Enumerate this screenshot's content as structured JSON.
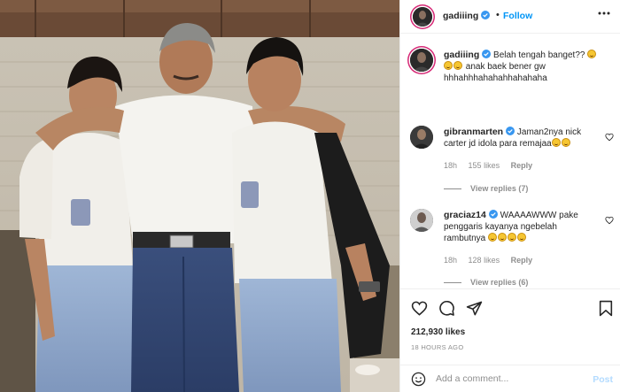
{
  "header": {
    "username": "gadiiing",
    "separator": "•",
    "follow_label": "Follow"
  },
  "caption": {
    "username": "gadiiing",
    "text_1": "Belah tengah banget??",
    "text_2": "anak baek bener gw hhhahhhahahahhahahaha"
  },
  "comments": [
    {
      "username": "gibranmarten",
      "text": "Jaman2nya nick carter jd idola para remajaa",
      "time": "18h",
      "likes": "155 likes",
      "reply_label": "Reply",
      "view_replies": "View replies (7)"
    },
    {
      "username": "graciaz14",
      "text": "WAAAAWWW pake penggaris kayanya ngebelah rambutnya",
      "time": "18h",
      "likes": "128 likes",
      "reply_label": "Reply",
      "view_replies": "View replies (6)"
    }
  ],
  "post": {
    "likes": "212,930 likes",
    "time": "18 HOURS AGO",
    "comment_placeholder": "Add a comment...",
    "post_label": "Post"
  },
  "colors": {
    "link_blue": "#0095f6",
    "verified_blue": "#3897f0",
    "muted": "#8e8e8e",
    "post_disabled": "#b3dbff"
  },
  "icons": [
    "more-icon",
    "verified-icon",
    "heart-icon",
    "comment-icon",
    "share-icon",
    "bookmark-icon",
    "emoji-icon"
  ]
}
